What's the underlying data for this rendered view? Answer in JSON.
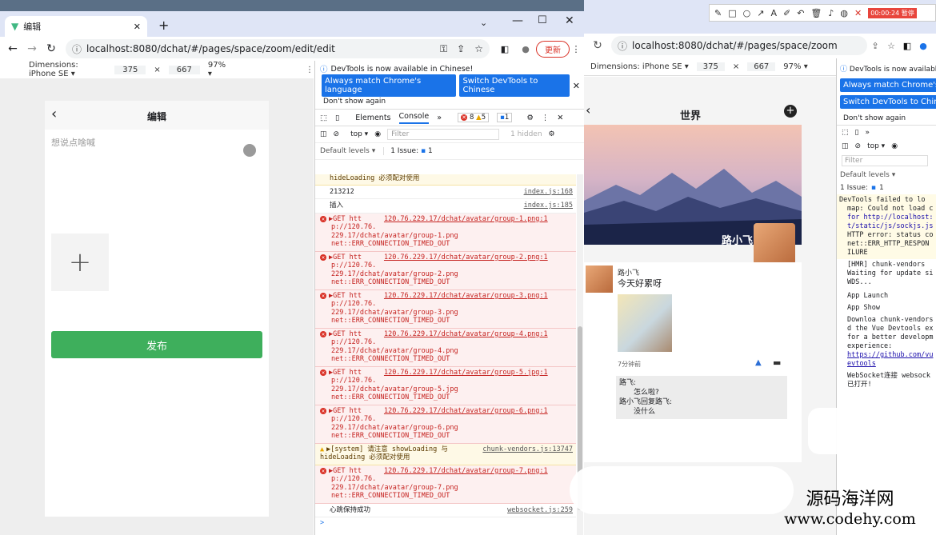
{
  "left_browser": {
    "tab_title": "编辑",
    "url": "localhost:8080/dchat/#/pages/space/zoom/edit/edit",
    "update_button": "更新",
    "device_toolbar": {
      "dimensions": "Dimensions: iPhone SE ▾",
      "width": "375",
      "times": "×",
      "height": "667",
      "zoom": "97% ▾"
    }
  },
  "edit_page": {
    "title": "编辑",
    "placeholder": "想说点啥喊",
    "add_glyph": "+",
    "publish_label": "发布"
  },
  "devtools_left": {
    "notice": "DevTools is now available in Chinese!",
    "match_language_button": "Always match Chrome's language",
    "switch_chinese_button": "Switch DevTools to Chinese",
    "dont_show": "Don't show again",
    "tabs": [
      "Elements",
      "Console"
    ],
    "more_tabs": "»",
    "error_count": "8",
    "warn_count": "5",
    "info_count": "1",
    "context": "top ▾",
    "filter_placeholder": "Filter",
    "hidden": "1 hidden",
    "default_levels": "Default levels ▾",
    "issue_label": "1 Issue:",
    "issue_count": "1",
    "lines": [
      {
        "kind": "warn",
        "text": "hideLoading 必须配对使用",
        "src": ""
      },
      {
        "kind": "info",
        "text": "213212",
        "src": "index.js:168"
      },
      {
        "kind": "info",
        "text": "插入",
        "src": "index.js:185"
      },
      {
        "kind": "err",
        "get": "▶GET htt",
        "src": "120.76.229.17/dchat/avatar/group-1.png:1",
        "l2": "p://120.76.",
        "l3": "229.17/dchat/avatar/group-1.png",
        "l4": "net::ERR_CONNECTION_TIMED_OUT"
      },
      {
        "kind": "err",
        "get": "▶GET htt",
        "src": "120.76.229.17/dchat/avatar/group-2.png:1",
        "l2": "p://120.76.",
        "l3": "229.17/dchat/avatar/group-2.png",
        "l4": "net::ERR_CONNECTION_TIMED_OUT"
      },
      {
        "kind": "err",
        "get": "▶GET htt",
        "src": "120.76.229.17/dchat/avatar/group-3.png:1",
        "l2": "p://120.76.",
        "l3": "229.17/dchat/avatar/group-3.png",
        "l4": "net::ERR_CONNECTION_TIMED_OUT"
      },
      {
        "kind": "err",
        "get": "▶GET htt",
        "src": "120.76.229.17/dchat/avatar/group-4.png:1",
        "l2": "p://120.76.",
        "l3": "229.17/dchat/avatar/group-4.png",
        "l4": "net::ERR_CONNECTION_TIMED_OUT"
      },
      {
        "kind": "err",
        "get": "▶GET htt",
        "src": "120.76.229.17/dchat/avatar/group-5.jpg:1",
        "l2": "p://120.76.",
        "l3": "229.17/dchat/avatar/group-5.jpg",
        "l4": "net::ERR_CONNECTION_TIMED_OUT"
      },
      {
        "kind": "err",
        "get": "▶GET htt",
        "src": "120.76.229.17/dchat/avatar/group-6.png:1",
        "l2": "p://120.76.",
        "l3": "229.17/dchat/avatar/group-6.png",
        "l4": "net::ERR_CONNECTION_TIMED_OUT"
      }
    ],
    "system_warn": "▶[system] 请注意 showLoading 与",
    "system_warn_src": "chunk-vendors.js:13747",
    "system_warn_2": "hideLoading 必须配对使用",
    "last_err": {
      "get": "▶GET htt",
      "src": "120.76.229.17/dchat/avatar/group-7.png:1",
      "l2": "p://120.76.",
      "l3": "229.17/dchat/avatar/group-7.png",
      "l4": "net::ERR_CONNECTION_TIMED_OUT"
    },
    "heartbeat": "心跳保持成功",
    "heartbeat_src": "websocket.js:259",
    "prompt": ">"
  },
  "right_browser": {
    "url": "localhost:8080/dchat/#/pages/space/zoom",
    "device_toolbar": {
      "dimensions": "Dimensions: iPhone SE ▾",
      "width": "375",
      "times": "×",
      "height": "667",
      "zoom": "97% ▾"
    }
  },
  "world_page": {
    "title": "世界",
    "username": "路小飞",
    "post_author": "路小飞",
    "post_text": "今天好累呀",
    "post_time": "7分钟前",
    "comments": [
      "路飞:",
      "怎么啦?",
      "路小飞回复路飞:",
      "没什么"
    ]
  },
  "devtools_right": {
    "notice": "DevTools is now available",
    "match_language_button": "Always match Chrome's lang",
    "switch_chinese_button": "Switch DevTools to Chinese",
    "dont_show": "Don't show again",
    "more_tabs": "»",
    "context": "top ▾",
    "filter_placeholder": "Filter",
    "default_levels": "Default levels ▾",
    "issue_label": "1 Issue:",
    "issue_count": "1",
    "lines": [
      "DevTools failed to lo",
      "map: Could not load c",
      "for http://localhost:",
      "t/static/js/sockjs.js",
      "HTTP error: status co",
      "net::ERR_HTTP_RESPON",
      "ILURE",
      "[HMR]  chunk-vendors",
      "Waiting for update si",
      "WDS...",
      "App Launch",
      "App Show",
      "Downloa chunk-vendors",
      "d the Vue Devtools ex",
      "for a better developm",
      "experience:",
      "https://github.com/vu",
      "evtools",
      "WebSocket连接 websock",
      "已打开!"
    ]
  },
  "annotation_toolbar": {
    "time": "00:00:24 暂停"
  },
  "watermark": {
    "cn": "源码海洋网",
    "url": "www.codehy.com"
  },
  "colors": {
    "accent": "#1a73e8",
    "publish_green": "#3eaf5c",
    "error_red": "#c5221f",
    "tab_strip": "#dfe5f6"
  }
}
